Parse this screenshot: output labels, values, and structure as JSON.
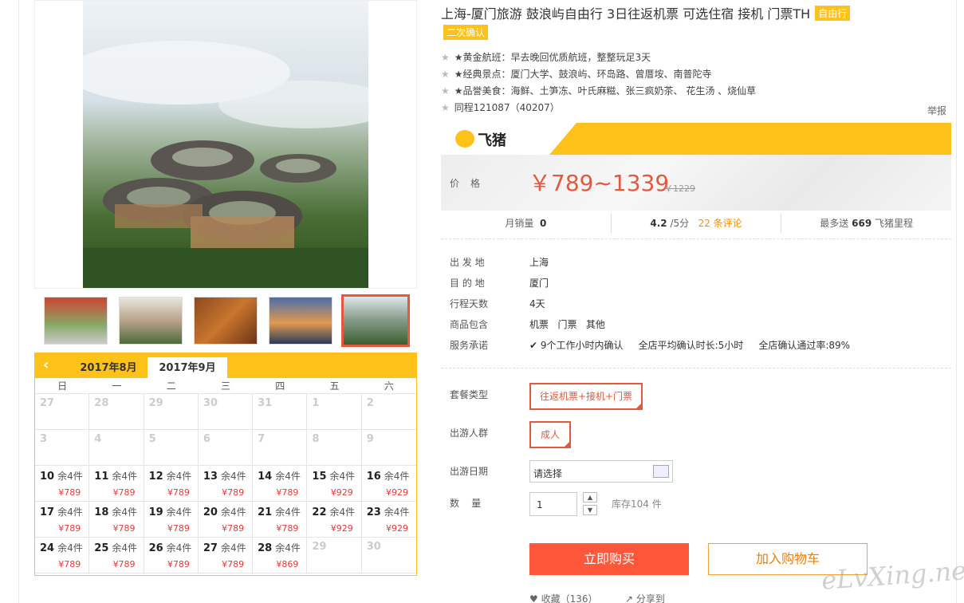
{
  "product": {
    "title": "上海-厦门旅游 鼓浪屿自由行 3日往返机票 可选住宿 接机 门票TH",
    "tag_free": "自由行",
    "tag_confirm": "二次确认",
    "features": [
      "★黄金航班：早去晚回优质航班，整整玩足3天",
      "★经典景点：厦门大学、鼓浪屿、环岛路、曾厝垵、南普陀寺",
      "★品誉美食：海鲜、土笋冻、叶氏麻糍、张三疯奶茶、 花生汤 、烧仙草",
      "同程121087（40207）"
    ],
    "report": "举报"
  },
  "brand": {
    "logo_text": "飞猪"
  },
  "pricing": {
    "label": "价格",
    "range": "￥789~1339",
    "original": "￥1229"
  },
  "stats": {
    "sales_label": "月销量",
    "sales_value": "0",
    "rating": "4.2",
    "rating_suffix": "/5分",
    "reviews": "22 条评论",
    "miles_prefix": "最多送",
    "miles_value": "669",
    "miles_suffix": "飞猪里程"
  },
  "info": [
    {
      "label": "出 发 地",
      "value": "上海"
    },
    {
      "label": "目 的 地",
      "value": "厦门"
    },
    {
      "label": "行程天数",
      "value": "4天"
    },
    {
      "label": "商品包含",
      "value": "机票   门票   其他"
    },
    {
      "label": "服务承诺",
      "value": "9个工作小时内确认     全店平均确认时长:5小时     全店确认通过率:89%"
    }
  ],
  "options": {
    "package_label": "套餐类型",
    "package_value": "往返机票+接机+门票",
    "crowd_label": "出游人群",
    "crowd_value": "成人",
    "date_label": "出游日期",
    "date_placeholder": "请选择",
    "qty_label": "数    量",
    "qty_value": "1",
    "stock": "库存104 件"
  },
  "actions": {
    "buy": "立即购买",
    "cart": "加入购物车",
    "favorite": "收藏（136）",
    "share": "分享到"
  },
  "watermark": "eLvXing.net",
  "calendar": {
    "months": [
      "2017年8月",
      "2017年9月"
    ],
    "weekdays": [
      "日",
      "一",
      "二",
      "三",
      "四",
      "五",
      "六"
    ],
    "days": [
      {
        "d": "27"
      },
      {
        "d": "28"
      },
      {
        "d": "29"
      },
      {
        "d": "30"
      },
      {
        "d": "31"
      },
      {
        "d": "1"
      },
      {
        "d": "2"
      },
      {
        "d": "3"
      },
      {
        "d": "4"
      },
      {
        "d": "5"
      },
      {
        "d": "6"
      },
      {
        "d": "7"
      },
      {
        "d": "8"
      },
      {
        "d": "9"
      },
      {
        "d": "10",
        "s": "余4件",
        "p": "¥789"
      },
      {
        "d": "11",
        "s": "余4件",
        "p": "¥789"
      },
      {
        "d": "12",
        "s": "余4件",
        "p": "¥789"
      },
      {
        "d": "13",
        "s": "余4件",
        "p": "¥789"
      },
      {
        "d": "14",
        "s": "余4件",
        "p": "¥789"
      },
      {
        "d": "15",
        "s": "余4件",
        "p": "¥929"
      },
      {
        "d": "16",
        "s": "余4件",
        "p": "¥929"
      },
      {
        "d": "17",
        "s": "余4件",
        "p": "¥789"
      },
      {
        "d": "18",
        "s": "余4件",
        "p": "¥789"
      },
      {
        "d": "19",
        "s": "余4件",
        "p": "¥789"
      },
      {
        "d": "20",
        "s": "余4件",
        "p": "¥789"
      },
      {
        "d": "21",
        "s": "余4件",
        "p": "¥789"
      },
      {
        "d": "22",
        "s": "余4件",
        "p": "¥929"
      },
      {
        "d": "23",
        "s": "余4件",
        "p": "¥929"
      },
      {
        "d": "24",
        "s": "余4件",
        "p": "¥789"
      },
      {
        "d": "25",
        "s": "余4件",
        "p": "¥789"
      },
      {
        "d": "26",
        "s": "余4件",
        "p": "¥789"
      },
      {
        "d": "27",
        "s": "余4件",
        "p": "¥789"
      },
      {
        "d": "28",
        "s": "余4件",
        "p": "¥869"
      },
      {
        "d": "29"
      },
      {
        "d": "30"
      }
    ]
  },
  "colors": {
    "accent": "#ffc21a",
    "price": "#e4583e",
    "buy": "#ff5739"
  }
}
